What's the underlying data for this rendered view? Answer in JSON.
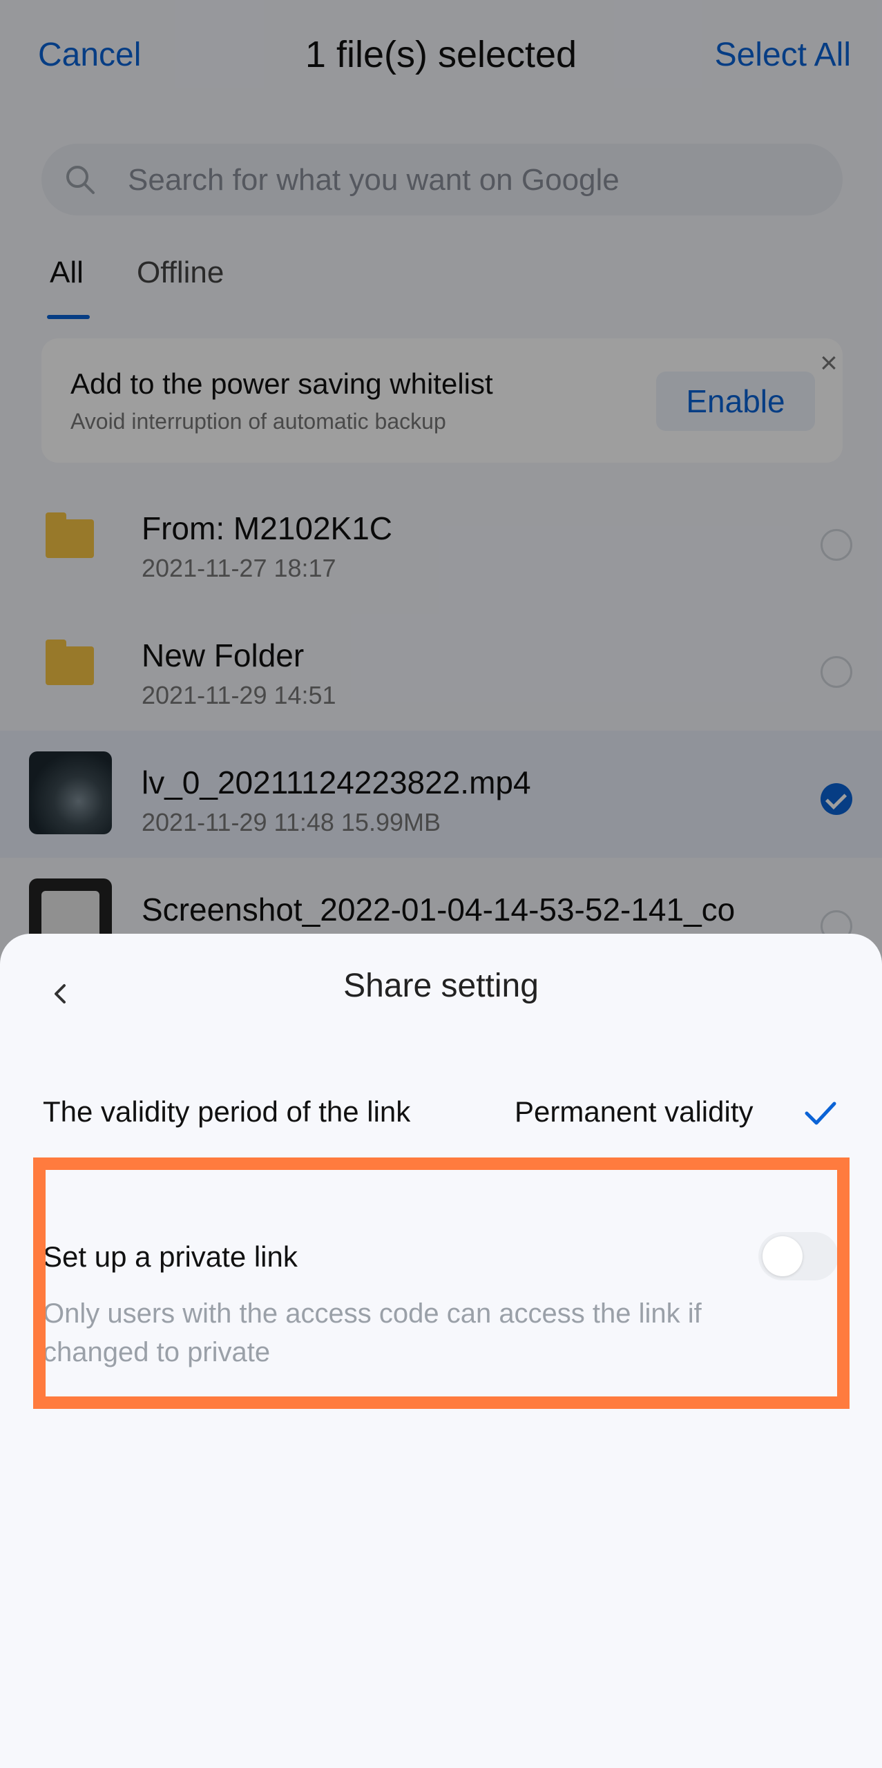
{
  "header": {
    "cancel_label": "Cancel",
    "title": "1 file(s) selected",
    "select_all_label": "Select All"
  },
  "search": {
    "placeholder": "Search for what you want on Google",
    "icon": "search-icon"
  },
  "tabs": [
    {
      "label": "All",
      "active": true
    },
    {
      "label": "Offline",
      "active": false
    }
  ],
  "banner": {
    "title": "Add to the power saving whitelist",
    "subtitle": "Avoid interruption of automatic backup",
    "enable_label": "Enable",
    "close_icon": "close-icon"
  },
  "files": [
    {
      "name": "From: M2102K1C",
      "meta": "2021-11-27  18:17",
      "type": "folder",
      "selected": false
    },
    {
      "name": "New Folder",
      "meta": "2021-11-29  14:51",
      "type": "folder",
      "selected": false
    },
    {
      "name": "lv_0_20211124223822.mp4",
      "meta": "2021-11-29  11:48  15.99MB",
      "type": "video",
      "selected": true
    },
    {
      "name": "Screenshot_2022-01-04-14-53-52-141_co",
      "meta": "",
      "type": "image",
      "selected": false
    }
  ],
  "share_sheet": {
    "title": "Share setting",
    "back_icon": "chevron-left-icon",
    "validity_label": "The validity period of the link",
    "validity_value": "Permanent validity",
    "validity_check_icon": "check-icon",
    "private_title": "Set up a private link",
    "private_description": "Only users with the access code can access the link if changed to private",
    "private_enabled": false
  },
  "colors": {
    "accent": "#0b63d6",
    "highlight": "#ff7b3e",
    "folder": "#f6c344"
  }
}
